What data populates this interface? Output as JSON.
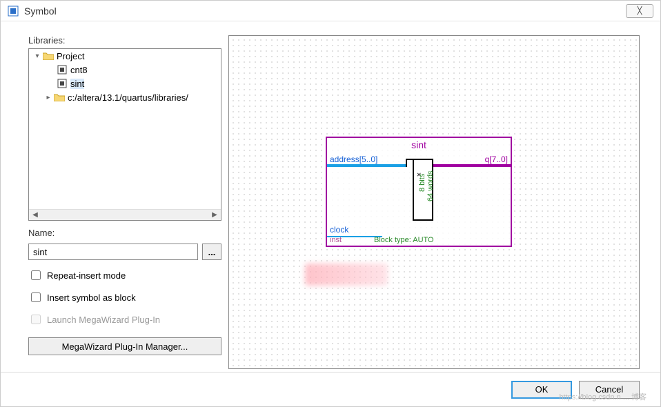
{
  "dialog": {
    "title": "Symbol",
    "close_glyph": "╳"
  },
  "libraries": {
    "label": "Libraries:",
    "tree": {
      "root": {
        "label": "Project",
        "expanded": true
      },
      "children": [
        {
          "label": "cnt8",
          "selected": false
        },
        {
          "label": "sint",
          "selected": true
        }
      ],
      "sibling": {
        "label": "c:/altera/13.1/quartus/libraries/",
        "expanded": false
      }
    }
  },
  "name": {
    "label": "Name:",
    "value": "sint",
    "browse_label": "..."
  },
  "options": {
    "repeat_insert": {
      "label": "Repeat-insert mode",
      "checked": false
    },
    "insert_as_block": {
      "label": "Insert symbol as block",
      "checked": false
    },
    "launch_mwiz": {
      "label": "Launch MegaWizard Plug-In",
      "checked": false,
      "disabled": true
    },
    "mwiz_button": "MegaWizard Plug-In Manager..."
  },
  "symbol": {
    "name": "sint",
    "ports": {
      "address": "address[5..0]",
      "q": "q[7..0]",
      "clock": "clock"
    },
    "inst": "inst",
    "block_type": "Block type: AUTO",
    "rom": {
      "bits": "8 bits",
      "words": "64 words",
      "x": "×"
    }
  },
  "buttons": {
    "ok": "OK",
    "cancel": "Cancel"
  },
  "watermark": "https://blog.csdn.n ... 博客"
}
